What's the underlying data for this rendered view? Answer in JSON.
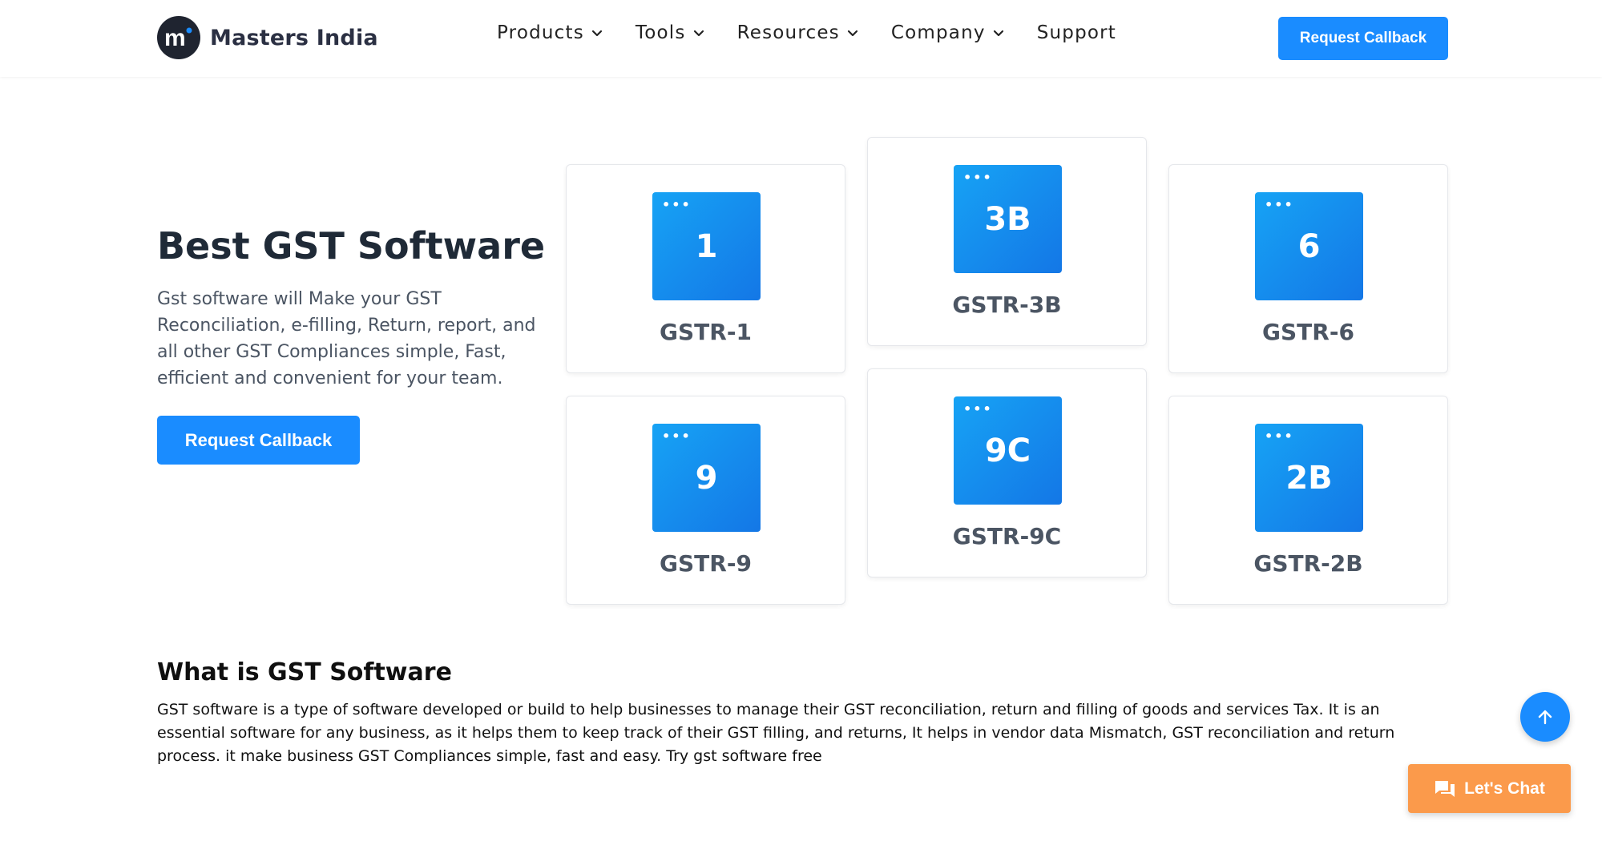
{
  "header": {
    "logo_text": "Masters India",
    "nav": [
      {
        "label": "Products",
        "has_dropdown": true
      },
      {
        "label": "Tools",
        "has_dropdown": true
      },
      {
        "label": "Resources",
        "has_dropdown": true
      },
      {
        "label": "Company",
        "has_dropdown": true
      },
      {
        "label": "Support",
        "has_dropdown": false
      }
    ],
    "cta_label": "Request Callback"
  },
  "hero": {
    "title": "Best GST Software",
    "description": "Gst software will Make your GST Reconciliation, e-filling, Return, report, and all other GST Compliances simple, Fast, efficient and convenient for your team.",
    "cta_label": "Request Callback"
  },
  "cards": [
    {
      "code": "1",
      "label": "GSTR-1"
    },
    {
      "code": "3B",
      "label": "GSTR-3B"
    },
    {
      "code": "6",
      "label": "GSTR-6"
    },
    {
      "code": "9",
      "label": "GSTR-9"
    },
    {
      "code": "9C",
      "label": "GSTR-9C"
    },
    {
      "code": "2B",
      "label": "GSTR-2B"
    }
  ],
  "about": {
    "title": "What is GST Software",
    "text": "GST software is a type of software developed or build to help businesses to manage their GST reconciliation, return and filling of goods and services Tax. It is an essential software for any business, as it helps them to keep track of their GST filling, and returns, It helps in vendor data Mismatch, GST reconciliation and return process. it make business GST Compliances simple, fast and easy. Try gst software free"
  },
  "floating": {
    "chat_label": "Let's Chat",
    "scroll_icon": "arrow-up-icon",
    "chat_icon": "chat-bubbles-icon"
  },
  "colors": {
    "brand_blue": "#1a8cff",
    "tile_gradient_start": "#16a3f5",
    "tile_gradient_end": "#1477e6",
    "chat_orange": "#fb9a4b"
  }
}
